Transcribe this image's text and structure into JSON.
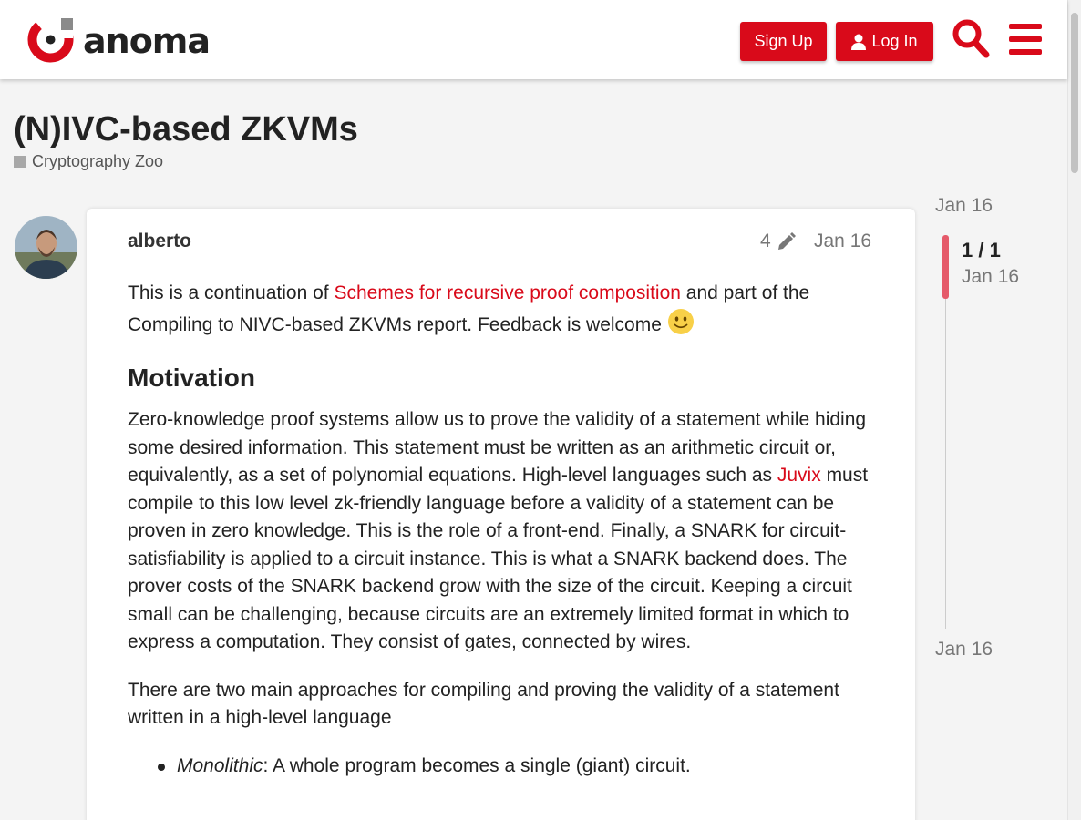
{
  "colors": {
    "accent": "#d90a1a",
    "timeline_bar": "#e55a6a"
  },
  "header": {
    "logo_text": "anoma",
    "signup_label": "Sign Up",
    "login_label": "Log In",
    "search_icon": "search-icon",
    "menu_icon": "hamburger-menu-icon"
  },
  "topic": {
    "title": "(N)IVC-based ZKVMs",
    "category": "Cryptography Zoo"
  },
  "post": {
    "author": "alberto",
    "edit_count": "4",
    "date": "Jan 16",
    "intro_before_link": "This is a continuation of ",
    "intro_link": "Schemes for recursive proof composition",
    "intro_after_link": " and part of the Compiling to NIVC-based ZKVMs report. Feedback is welcome ",
    "heading_motivation": "Motivation",
    "para1_before_link": "Zero-knowledge proof systems allow us to prove the validity of a statement while hiding some desired information. This statement must be written as an arithmetic circuit or, equivalently, as a set of polynomial equations. High-level languages such as ",
    "para1_link": "Juvix",
    "para1_after_link": " must compile to this low level zk-friendly language before a validity of a statement can be proven in zero knowledge. This is the role of a front-end. Finally, a SNARK for circuit-satisfiability is applied to a circuit instance. This is what a SNARK backend does. The prover costs of the SNARK backend grow with the size of the circuit. Keeping a circuit small can be challenging, because circuits are an extremely limited format in which to express a computation. They consist of gates, connected by wires.",
    "para2": "There are two main approaches for compiling and proving the validity of a statement written in a high-level language",
    "list_item1_em": "Monolithic",
    "list_item1_rest": ": A whole program becomes a single (giant) circuit."
  },
  "timeline": {
    "start_date": "Jan 16",
    "counter": "1 / 1",
    "current_date": "Jan 16",
    "end_date": "Jan 16"
  }
}
